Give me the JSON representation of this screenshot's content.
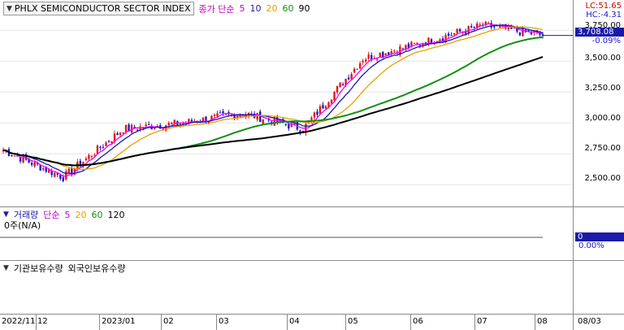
{
  "price_panel": {
    "index_name": "PHLX SEMICONDUCTOR SECTOR INDEX",
    "ma_prefix": "종가 단순",
    "ma_periods": [
      "5",
      "10",
      "20",
      "60",
      "90"
    ],
    "ma_colors": [
      "#ff00ff",
      "#1a1aa8",
      "#e8a000",
      "#109010",
      "#000000"
    ],
    "lc_label": "LC:51.65",
    "hc_label": "HC:-4.31",
    "current_price": "3,708.08",
    "change_pct": "-0.09%",
    "scale_ticks": [
      "3,750.00",
      "3,500.00",
      "3,250.00",
      "3,000.00",
      "2,750.00",
      "2,500.00"
    ]
  },
  "volume_panel": {
    "title": "거래량",
    "ma_prefix": "단순",
    "ma_periods": [
      "5",
      "20",
      "60",
      "120"
    ],
    "ma_colors": [
      "#ff00ff",
      "#e8a000",
      "#109010",
      "#000000"
    ],
    "volume_text": "0주(N/A)",
    "current_value": "0",
    "change_pct": "0.00%"
  },
  "inst_panel": {
    "series": [
      "기관보유수량",
      "외국인보유수량"
    ]
  },
  "x_axis": {
    "labels": [
      "2022/11",
      "12",
      "2023/01",
      "02",
      "03",
      "04",
      "05",
      "06",
      "07",
      "08",
      "08/03"
    ]
  },
  "chart_data": {
    "type": "candlestick",
    "title": "PHLX SEMICONDUCTOR SECTOR INDEX",
    "x_range": [
      "2022/11",
      "2023/08/03"
    ],
    "ylim": [
      2350,
      3850
    ],
    "monthly_closes": [
      {
        "month": "2022/11",
        "close": 2780
      },
      {
        "month": "2022/12",
        "close": 2560
      },
      {
        "month": "2023/01",
        "close": 2950
      },
      {
        "month": "2023/02",
        "close": 3000
      },
      {
        "month": "2023/03",
        "close": 3080
      },
      {
        "month": "2023/04",
        "close": 2950
      },
      {
        "month": "2023/05",
        "close": 3520
      },
      {
        "month": "2023/06",
        "close": 3650
      },
      {
        "month": "2023/07",
        "close": 3790
      },
      {
        "month": "2023/08",
        "close": 3708.08
      }
    ],
    "last_close": 3708.08,
    "last_change_pct": -0.09
  }
}
